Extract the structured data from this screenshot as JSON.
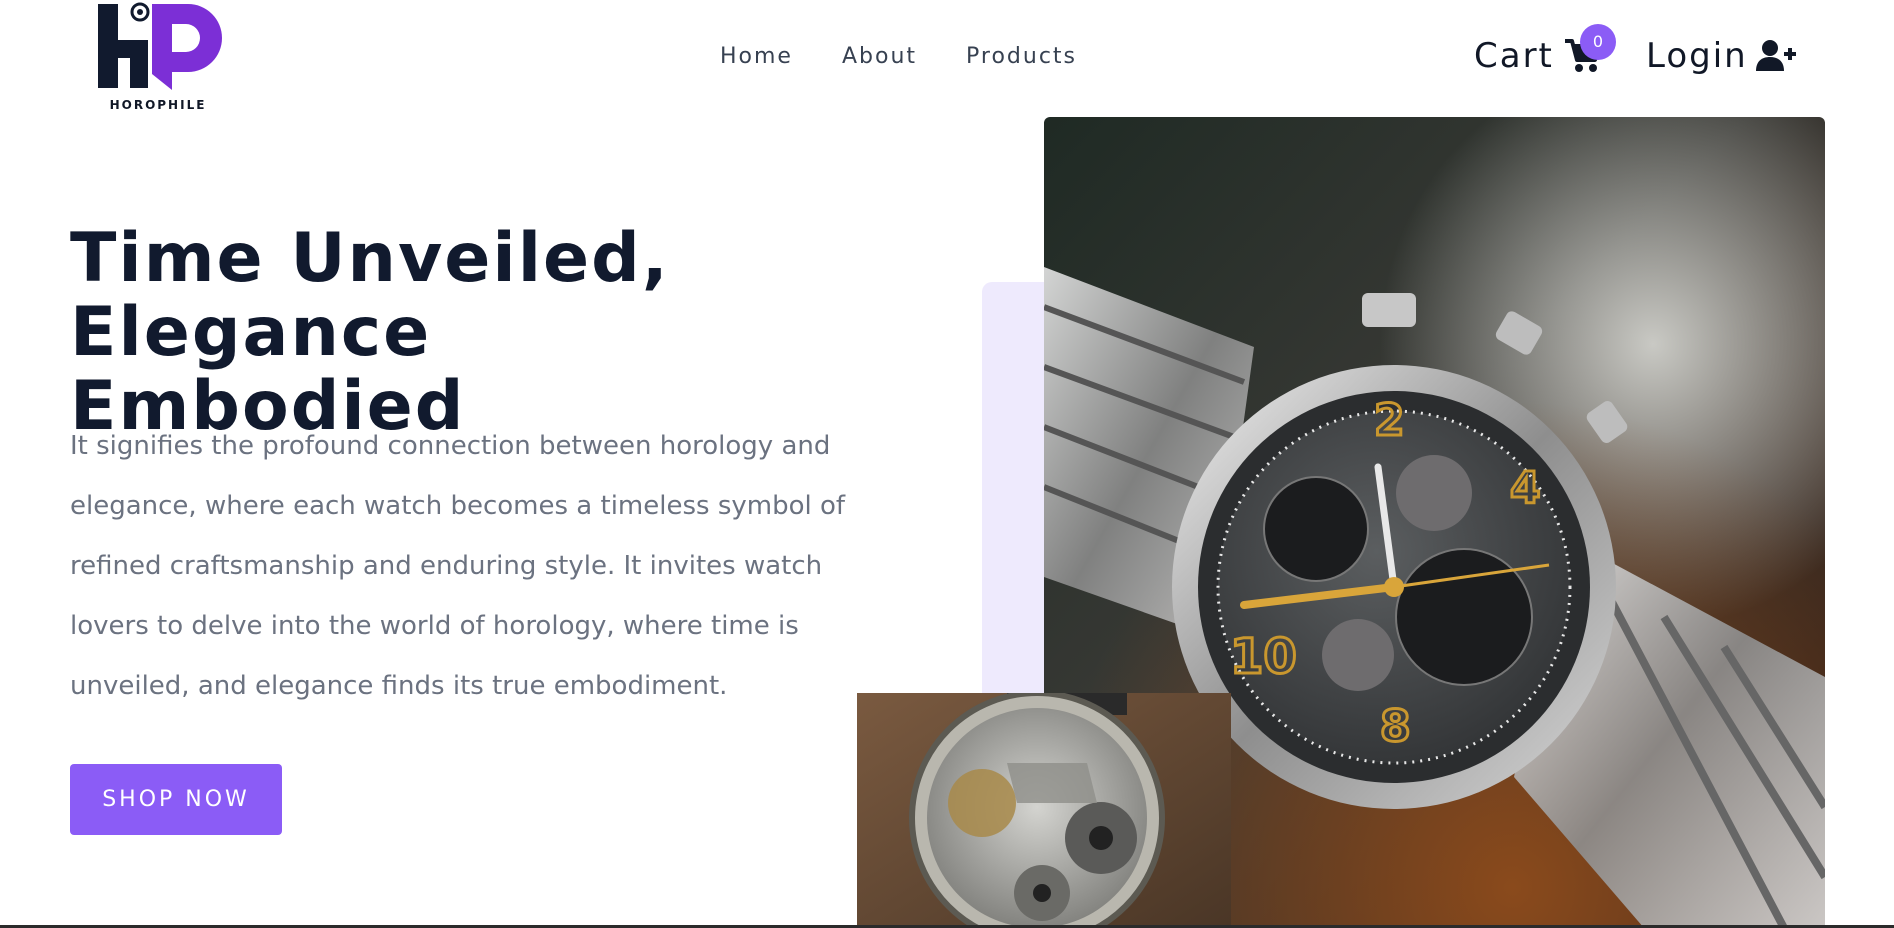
{
  "brand": {
    "name": "HOROPHILE",
    "accent": "#8b5cf6",
    "dark": "#111a2e"
  },
  "nav": {
    "items": [
      {
        "label": "Home"
      },
      {
        "label": "About"
      },
      {
        "label": "Products"
      }
    ]
  },
  "cart": {
    "label": "Cart",
    "count": "0",
    "icon": "cart-icon"
  },
  "login": {
    "label": "Login",
    "icon": "user-plus-icon"
  },
  "hero": {
    "title_line1": "Time Unveiled,",
    "title_line2": "Elegance Embodied",
    "description": "It signifies the profound connection between horology and elegance, where each watch becomes a timeless symbol of refined craftsmanship and enduring style. It invites watch lovers to delve into the world of horology, where time is unveiled, and elegance finds its true embodiment.",
    "cta_label": "SHOP NOW"
  },
  "images": {
    "main": "chronograph-wristwatch-photo",
    "secondary": "pocket-watch-movement-photo"
  }
}
